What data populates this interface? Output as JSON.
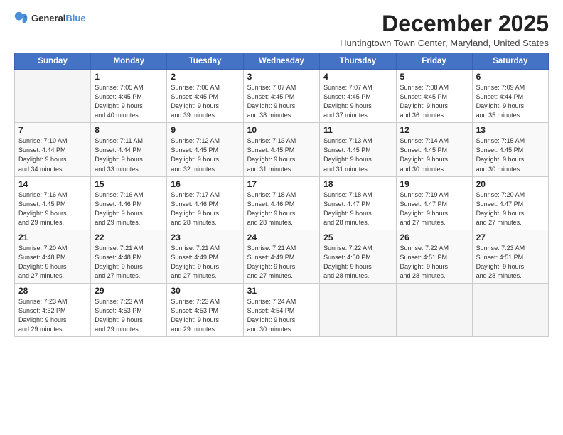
{
  "header": {
    "logo_general": "General",
    "logo_blue": "Blue",
    "month_title": "December 2025",
    "location": "Huntingtown Town Center, Maryland, United States"
  },
  "days_of_week": [
    "Sunday",
    "Monday",
    "Tuesday",
    "Wednesday",
    "Thursday",
    "Friday",
    "Saturday"
  ],
  "weeks": [
    [
      {
        "day": "",
        "info": ""
      },
      {
        "day": "1",
        "info": "Sunrise: 7:05 AM\nSunset: 4:45 PM\nDaylight: 9 hours\nand 40 minutes."
      },
      {
        "day": "2",
        "info": "Sunrise: 7:06 AM\nSunset: 4:45 PM\nDaylight: 9 hours\nand 39 minutes."
      },
      {
        "day": "3",
        "info": "Sunrise: 7:07 AM\nSunset: 4:45 PM\nDaylight: 9 hours\nand 38 minutes."
      },
      {
        "day": "4",
        "info": "Sunrise: 7:07 AM\nSunset: 4:45 PM\nDaylight: 9 hours\nand 37 minutes."
      },
      {
        "day": "5",
        "info": "Sunrise: 7:08 AM\nSunset: 4:45 PM\nDaylight: 9 hours\nand 36 minutes."
      },
      {
        "day": "6",
        "info": "Sunrise: 7:09 AM\nSunset: 4:44 PM\nDaylight: 9 hours\nand 35 minutes."
      }
    ],
    [
      {
        "day": "7",
        "info": "Sunrise: 7:10 AM\nSunset: 4:44 PM\nDaylight: 9 hours\nand 34 minutes."
      },
      {
        "day": "8",
        "info": "Sunrise: 7:11 AM\nSunset: 4:44 PM\nDaylight: 9 hours\nand 33 minutes."
      },
      {
        "day": "9",
        "info": "Sunrise: 7:12 AM\nSunset: 4:45 PM\nDaylight: 9 hours\nand 32 minutes."
      },
      {
        "day": "10",
        "info": "Sunrise: 7:13 AM\nSunset: 4:45 PM\nDaylight: 9 hours\nand 31 minutes."
      },
      {
        "day": "11",
        "info": "Sunrise: 7:13 AM\nSunset: 4:45 PM\nDaylight: 9 hours\nand 31 minutes."
      },
      {
        "day": "12",
        "info": "Sunrise: 7:14 AM\nSunset: 4:45 PM\nDaylight: 9 hours\nand 30 minutes."
      },
      {
        "day": "13",
        "info": "Sunrise: 7:15 AM\nSunset: 4:45 PM\nDaylight: 9 hours\nand 30 minutes."
      }
    ],
    [
      {
        "day": "14",
        "info": "Sunrise: 7:16 AM\nSunset: 4:45 PM\nDaylight: 9 hours\nand 29 minutes."
      },
      {
        "day": "15",
        "info": "Sunrise: 7:16 AM\nSunset: 4:46 PM\nDaylight: 9 hours\nand 29 minutes."
      },
      {
        "day": "16",
        "info": "Sunrise: 7:17 AM\nSunset: 4:46 PM\nDaylight: 9 hours\nand 28 minutes."
      },
      {
        "day": "17",
        "info": "Sunrise: 7:18 AM\nSunset: 4:46 PM\nDaylight: 9 hours\nand 28 minutes."
      },
      {
        "day": "18",
        "info": "Sunrise: 7:18 AM\nSunset: 4:47 PM\nDaylight: 9 hours\nand 28 minutes."
      },
      {
        "day": "19",
        "info": "Sunrise: 7:19 AM\nSunset: 4:47 PM\nDaylight: 9 hours\nand 27 minutes."
      },
      {
        "day": "20",
        "info": "Sunrise: 7:20 AM\nSunset: 4:47 PM\nDaylight: 9 hours\nand 27 minutes."
      }
    ],
    [
      {
        "day": "21",
        "info": "Sunrise: 7:20 AM\nSunset: 4:48 PM\nDaylight: 9 hours\nand 27 minutes."
      },
      {
        "day": "22",
        "info": "Sunrise: 7:21 AM\nSunset: 4:48 PM\nDaylight: 9 hours\nand 27 minutes."
      },
      {
        "day": "23",
        "info": "Sunrise: 7:21 AM\nSunset: 4:49 PM\nDaylight: 9 hours\nand 27 minutes."
      },
      {
        "day": "24",
        "info": "Sunrise: 7:21 AM\nSunset: 4:49 PM\nDaylight: 9 hours\nand 27 minutes."
      },
      {
        "day": "25",
        "info": "Sunrise: 7:22 AM\nSunset: 4:50 PM\nDaylight: 9 hours\nand 28 minutes."
      },
      {
        "day": "26",
        "info": "Sunrise: 7:22 AM\nSunset: 4:51 PM\nDaylight: 9 hours\nand 28 minutes."
      },
      {
        "day": "27",
        "info": "Sunrise: 7:23 AM\nSunset: 4:51 PM\nDaylight: 9 hours\nand 28 minutes."
      }
    ],
    [
      {
        "day": "28",
        "info": "Sunrise: 7:23 AM\nSunset: 4:52 PM\nDaylight: 9 hours\nand 29 minutes."
      },
      {
        "day": "29",
        "info": "Sunrise: 7:23 AM\nSunset: 4:53 PM\nDaylight: 9 hours\nand 29 minutes."
      },
      {
        "day": "30",
        "info": "Sunrise: 7:23 AM\nSunset: 4:53 PM\nDaylight: 9 hours\nand 29 minutes."
      },
      {
        "day": "31",
        "info": "Sunrise: 7:24 AM\nSunset: 4:54 PM\nDaylight: 9 hours\nand 30 minutes."
      },
      {
        "day": "",
        "info": ""
      },
      {
        "day": "",
        "info": ""
      },
      {
        "day": "",
        "info": ""
      }
    ]
  ]
}
